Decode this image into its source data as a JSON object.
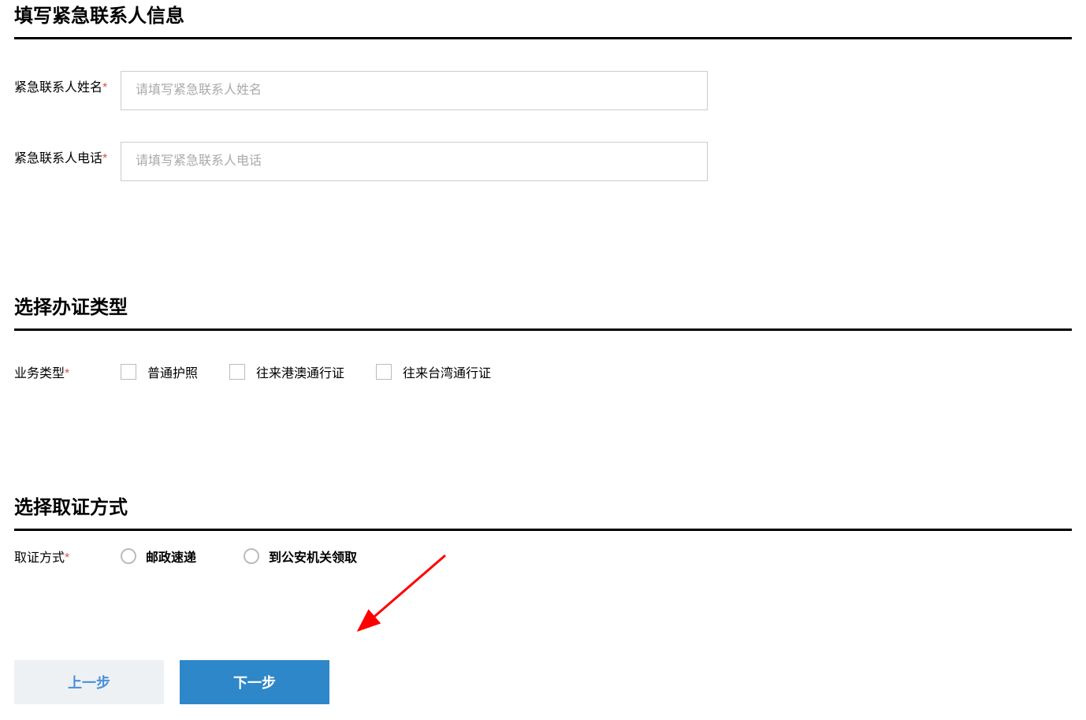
{
  "section1": {
    "title": "填写紧急联系人信息",
    "fields": {
      "contact_name": {
        "label": "紧急联系人姓名",
        "placeholder": "请填写紧急联系人姓名",
        "value": ""
      },
      "contact_phone": {
        "label": "紧急联系人电话",
        "placeholder": "请填写紧急联系人电话",
        "value": ""
      }
    }
  },
  "section2": {
    "title": "选择办证类型",
    "business_type_label": "业务类型",
    "options": [
      "普通护照",
      "往来港澳通行证",
      "往来台湾通行证"
    ]
  },
  "section3": {
    "title": "选择取证方式",
    "pickup_label": "取证方式",
    "options": [
      "邮政速递",
      "到公安机关领取"
    ]
  },
  "buttons": {
    "prev": "上一步",
    "next": "下一步"
  },
  "required_marker": "*"
}
